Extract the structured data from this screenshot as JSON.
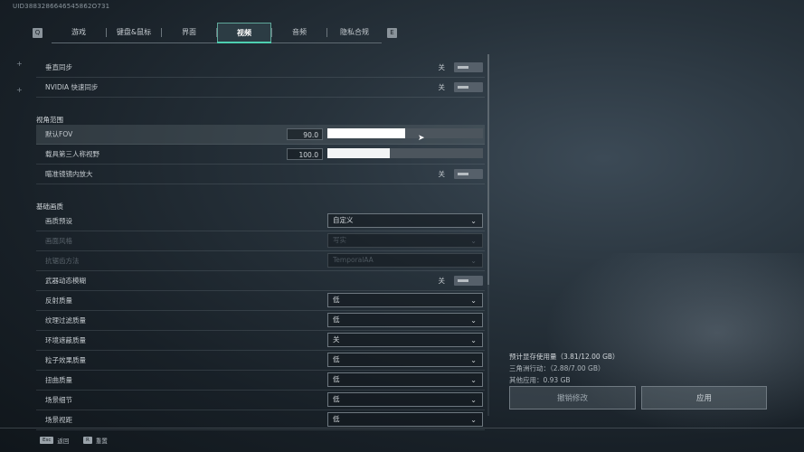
{
  "uid": "UID3883286646545862O731",
  "keys": {
    "left": "Q",
    "right": "E"
  },
  "tabs": [
    "游戏",
    "键盘&鼠标",
    "界面",
    "视频",
    "音频",
    "隐私合规"
  ],
  "active_tab": "视频",
  "sync": [
    {
      "label": "垂直同步",
      "state": "关"
    },
    {
      "label": "NVIDIA 快速同步",
      "state": "关"
    }
  ],
  "fov_section": {
    "title": "视角范围",
    "default_fov": {
      "label": "默认FOV",
      "value": "90.0",
      "fill": 0.5
    },
    "vehicle_fov": {
      "label": "载具第三人称视野",
      "value": "100.0",
      "fill": 0.4
    },
    "scope_zoom": {
      "label": "瞄准镜镜内放大",
      "state": "关"
    }
  },
  "quality_section": {
    "title": "基础画质",
    "rows": [
      {
        "label": "画质预设",
        "value": "自定义",
        "type": "select",
        "dim": false
      },
      {
        "label": "画面风格",
        "value": "写实",
        "type": "select",
        "dim": true
      },
      {
        "label": "抗锯齿方法",
        "value": "TemporalAA",
        "type": "select",
        "dim": true
      },
      {
        "label": "武器动态模糊",
        "value": "关",
        "type": "toggle",
        "dim": false
      },
      {
        "label": "反射质量",
        "value": "低",
        "type": "select",
        "dim": false
      },
      {
        "label": "纹理过滤质量",
        "value": "低",
        "type": "select",
        "dim": false
      },
      {
        "label": "环境遮蔽质量",
        "value": "关",
        "type": "select",
        "dim": false
      },
      {
        "label": "粒子效果质量",
        "value": "低",
        "type": "select",
        "dim": false
      },
      {
        "label": "扭曲质量",
        "value": "低",
        "type": "select",
        "dim": false
      },
      {
        "label": "场景细节",
        "value": "低",
        "type": "select",
        "dim": false
      },
      {
        "label": "场景视距",
        "value": "低",
        "type": "select",
        "dim": false
      }
    ]
  },
  "vram": {
    "estimate": "预计显存使用量（3.81/12.00 GB）",
    "delta": "三角洲行动：（2.88/7.00 GB）",
    "other": "其他应用：0.93 GB"
  },
  "buttons": {
    "undo": "撤销修改",
    "apply": "应用"
  },
  "bottom_hints": [
    {
      "key": "Esc",
      "label": "返回"
    },
    {
      "key": "R",
      "label": "重置"
    }
  ],
  "colors": {
    "accent": "#4ecfb0"
  }
}
